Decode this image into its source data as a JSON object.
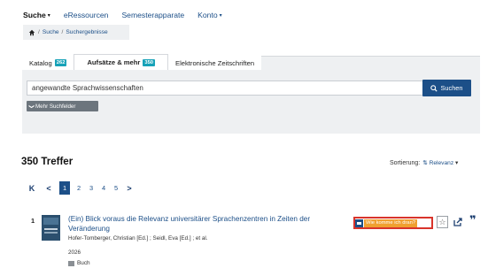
{
  "nav": {
    "items": [
      {
        "label": "Suche",
        "caret": "▾"
      },
      {
        "label": "eRessourcen",
        "caret": ""
      },
      {
        "label": "Semesterapparate",
        "caret": ""
      },
      {
        "label": "Konto",
        "caret": "▾"
      }
    ]
  },
  "breadcrumb": {
    "items": [
      "Suche",
      "Suchergebnisse"
    ],
    "separator": "/"
  },
  "tabs": [
    {
      "label": "Katalog",
      "count": "262"
    },
    {
      "label": "Aufsätze & mehr",
      "count": "350"
    },
    {
      "label": "Elektronische Zeitschriften",
      "count": ""
    }
  ],
  "search": {
    "value": "angewandte Sprachwissenschaften",
    "clear": "×",
    "button": "Suchen",
    "more_fields": "Mehr Suchfelder",
    "more_icon": "❯"
  },
  "results": {
    "count_label": "350 Treffer",
    "sort_label": "Sortierung:",
    "sort_icon": "⇅",
    "sort_value": "Relevanz",
    "sort_caret": "▾"
  },
  "pagination": {
    "first": "K",
    "prev": "<",
    "pages": [
      "1",
      "2",
      "3",
      "4",
      "5"
    ],
    "next": ">"
  },
  "result_item": {
    "number": "1",
    "title_line1": "(Ein) Blick voraus die Relevanz universitärer Sprachenzentren in Zeiten der",
    "title_line2": "Veränderung",
    "authors": "Hofer-Tomberger, Christian [Ed.] ; Seidl, Eva [Ed.] ; et al.",
    "year": "2026",
    "type": "Buch",
    "availability_label": "Wie komme ich dran?",
    "star": "☆",
    "cite": "❞"
  },
  "colors": {
    "primary": "#1c4f88",
    "badge": "#17a2b8",
    "highlight": "#d9342b",
    "availability": "#f0a030"
  }
}
